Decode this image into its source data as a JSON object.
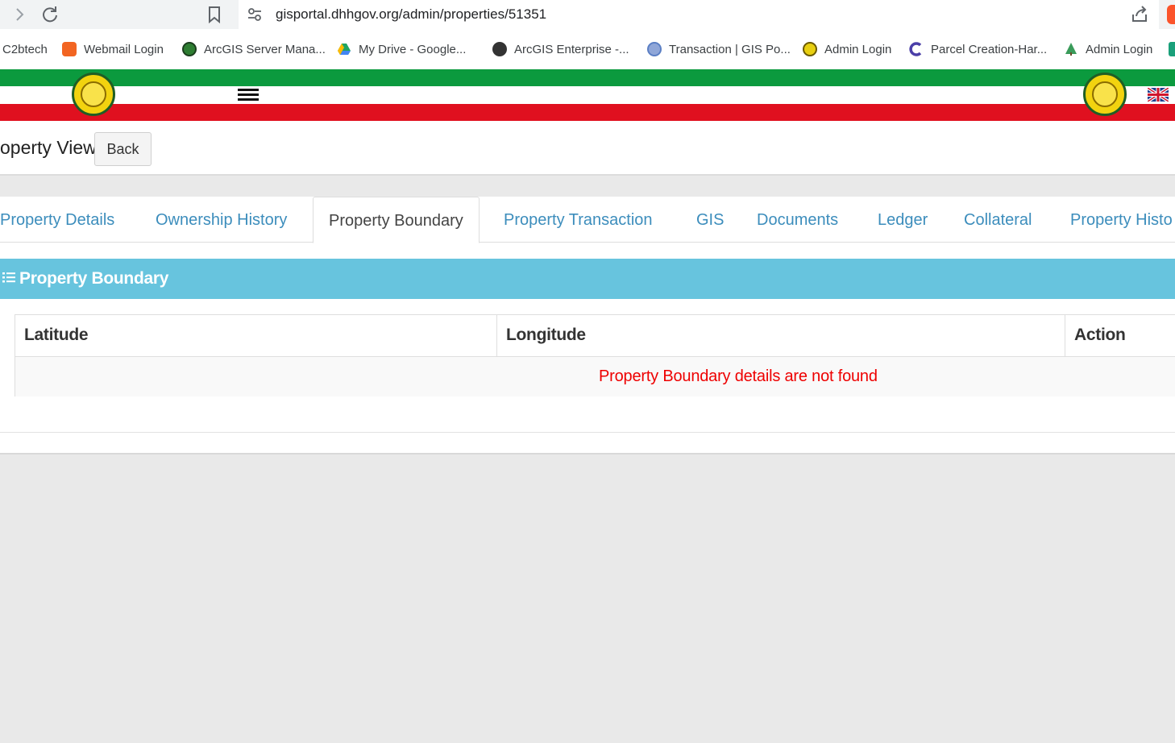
{
  "browser": {
    "url": "gisportal.dhhgov.org/admin/properties/51351",
    "bookmarks": [
      {
        "label": "C2btech",
        "icon": "none"
      },
      {
        "label": "Webmail Login",
        "icon": "cpanel-icon",
        "color": "#f26522"
      },
      {
        "label": "ArcGIS Server Mana...",
        "icon": "globe-icon",
        "color": "#2e7d32"
      },
      {
        "label": "My Drive - Google...",
        "icon": "google-drive-icon",
        "color": "#1fa463"
      },
      {
        "label": "ArcGIS Enterprise -...",
        "icon": "globe-dark-icon",
        "color": "#333333"
      },
      {
        "label": "Transaction | GIS Po...",
        "icon": "gis-portal-icon",
        "color": "#5b7fc4"
      },
      {
        "label": "Admin Login",
        "icon": "emblem-icon",
        "color": "#d4b800"
      },
      {
        "label": "Parcel Creation-Har...",
        "icon": "c-logo-icon",
        "color": "#4b3fa8"
      },
      {
        "label": "Admin Login",
        "icon": "tree-icon",
        "color": "#3a9b5a"
      }
    ]
  },
  "header": {
    "logo_left": "emblem-icon",
    "logo_right": "emblem-icon",
    "menu_icon": "hamburger-icon",
    "language_icon": "uk-flag-icon",
    "colors": {
      "green": "#0b9a3e",
      "white": "#ffffff",
      "red": "#e0101f"
    }
  },
  "titlebar": {
    "title": "operty View",
    "back_label": "Back"
  },
  "tabs": [
    {
      "label": "Property Details",
      "active": false
    },
    {
      "label": "Ownership History",
      "active": false
    },
    {
      "label": "Property Boundary",
      "active": true
    },
    {
      "label": "Property Transaction",
      "active": false
    },
    {
      "label": "GIS",
      "active": false
    },
    {
      "label": "Documents",
      "active": false
    },
    {
      "label": "Ledger",
      "active": false
    },
    {
      "label": "Collateral",
      "active": false
    },
    {
      "label": "Property Histo",
      "active": false
    }
  ],
  "panel": {
    "title": "Property Boundary",
    "icon": "list-icon",
    "header_color": "#67c4de",
    "table": {
      "columns": [
        "Latitude",
        "Longitude",
        "Action"
      ],
      "empty_message": "Property Boundary details are not found",
      "empty_color": "#ee0000"
    }
  }
}
